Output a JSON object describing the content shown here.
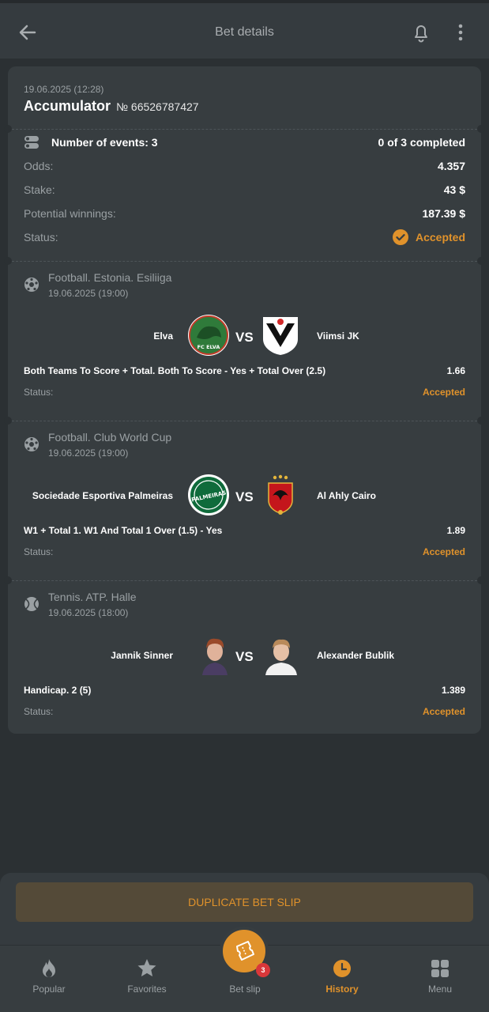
{
  "header": {
    "title": "Bet details"
  },
  "bet": {
    "date": "19.06.2025 (12:28)",
    "type": "Accumulator",
    "number": "№ 66526787427",
    "events_label": "Number of events: 3",
    "completed": "0 of 3 completed",
    "odds_label": "Odds:",
    "odds": "4.357",
    "stake_label": "Stake:",
    "stake": "43 $",
    "winnings_label": "Potential winnings:",
    "winnings": "187.39 $",
    "status_label": "Status:",
    "status": "Accepted"
  },
  "events": [
    {
      "sport": "Football. Estonia. Esiliiga",
      "date": "19.06.2025 (19:00)",
      "team1": "Elva",
      "team2": "Viimsi JK",
      "vs": "VS",
      "market": "Both Teams To Score + Total. Both To Score - Yes + Total Over (2.5)",
      "odd": "1.66",
      "status_label": "Status:",
      "status": "Accepted",
      "logo1_text": "FC ELVA"
    },
    {
      "sport": "Football. Club World Cup",
      "date": "19.06.2025 (19:00)",
      "team1": "Sociedade Esportiva Palmeiras",
      "team2": "Al Ahly Cairo",
      "vs": "VS",
      "market": "W1 + Total 1. W1 And Total 1 Over (1.5) - Yes",
      "odd": "1.89",
      "status_label": "Status:",
      "status": "Accepted",
      "logo1_text": "PALMEIRAS"
    },
    {
      "sport": "Tennis. ATP. Halle",
      "date": "19.06.2025 (18:00)",
      "team1": "Jannik Sinner",
      "team2": "Alexander Bublik",
      "vs": "VS",
      "market": "Handicap. 2 (5)",
      "odd": "1.389",
      "status_label": "Status:",
      "status": "Accepted"
    }
  ],
  "duplicate_button": "DUPLICATE BET SLIP",
  "nav": {
    "popular": "Popular",
    "favorites": "Favorites",
    "betslip": "Bet slip",
    "betslip_badge": "3",
    "history": "History",
    "menu": "Menu"
  },
  "colors": {
    "accent": "#e0922b",
    "background": "#2b3033",
    "card": "#373d40"
  }
}
